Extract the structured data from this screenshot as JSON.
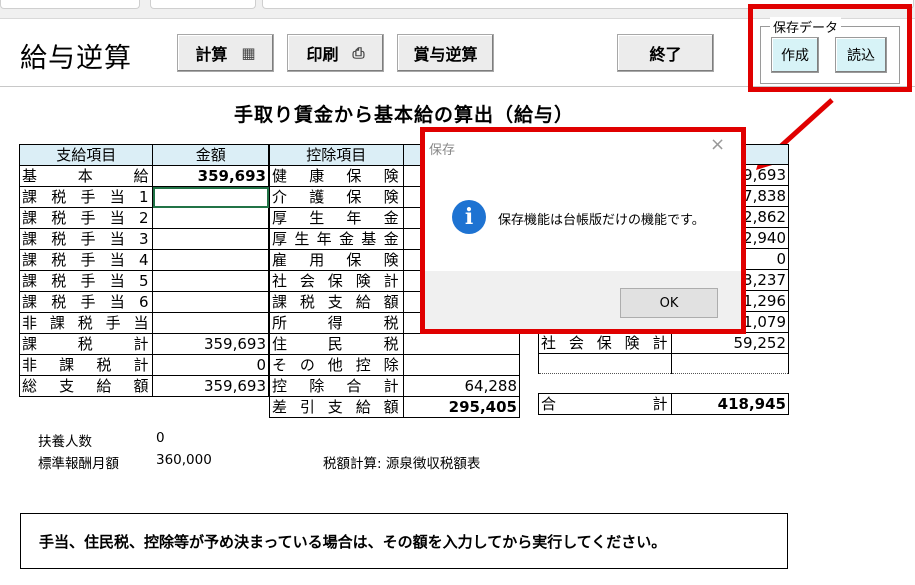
{
  "app": {
    "title": "給与逆算"
  },
  "toolbar": {
    "calc_label": "計算",
    "print_label": "印刷",
    "bonus_label": "賞与逆算",
    "exit_label": "終了"
  },
  "save_group": {
    "legend": "保存データ",
    "create_label": "作成",
    "load_label": "読込"
  },
  "heading": "手取り賃金から基本給の算出（給与）",
  "payment_table": {
    "headers": [
      "支給項目",
      "金額"
    ],
    "rows": [
      {
        "label": "基本給",
        "value": "359,693"
      },
      {
        "label": "課税手当1",
        "value": ""
      },
      {
        "label": "課税手当2",
        "value": ""
      },
      {
        "label": "課税手当3",
        "value": ""
      },
      {
        "label": "課税手当4",
        "value": ""
      },
      {
        "label": "課税手当5",
        "value": ""
      },
      {
        "label": "課税手当6",
        "value": ""
      },
      {
        "label": "非課税手当",
        "value": ""
      },
      {
        "label": "課税計",
        "value": "359,693"
      },
      {
        "label": "非課税計",
        "value": "0"
      },
      {
        "label": "総支給額",
        "value": "359,693"
      }
    ]
  },
  "deduction_table": {
    "headers": [
      "控除項目"
    ],
    "rows": [
      {
        "label": "健康保険",
        "value": ""
      },
      {
        "label": "介護保険",
        "value": ""
      },
      {
        "label": "厚生年金",
        "value": ""
      },
      {
        "label": "厚生年金基金",
        "value": ""
      },
      {
        "label": "雇用保険",
        "value": ""
      },
      {
        "label": "社会保険計",
        "value": ""
      },
      {
        "label": "課税支給額",
        "value": ""
      },
      {
        "label": "所得税",
        "value": ""
      },
      {
        "label": "住民税",
        "value": ""
      },
      {
        "label": "その他控除",
        "value": ""
      },
      {
        "label": "控除合計",
        "value": "64,288"
      },
      {
        "label": "差引支給額",
        "value": "295,405"
      }
    ]
  },
  "right_table": {
    "values": [
      "9,693",
      "7,838",
      "2,862",
      "2,940",
      "0",
      "3,237",
      "1,296",
      "1,079"
    ],
    "social_label": "社会保険計",
    "social_value": "59,252",
    "total_label": "合計",
    "total_value": "418,945"
  },
  "info": {
    "dependents_label": "扶養人数",
    "dependents_value": "0",
    "standard_label": "標準報酬月額",
    "standard_value": "360,000",
    "tax_calc": "税額計算:  源泉徴収税額表"
  },
  "message": "手当、住民税、控除等が予め決まっている場合は、その額を入力してから実行してください。",
  "dialog": {
    "title": "保存",
    "close": "×",
    "icon": "i",
    "text": "保存機能は台帳版だけの機能です。",
    "ok_label": "OK"
  },
  "colors": {
    "highlight": "#e00000",
    "header_bg": "#dbeef6",
    "save_button_bg": "#d7f3f7",
    "info_icon": "#1e73d2"
  }
}
